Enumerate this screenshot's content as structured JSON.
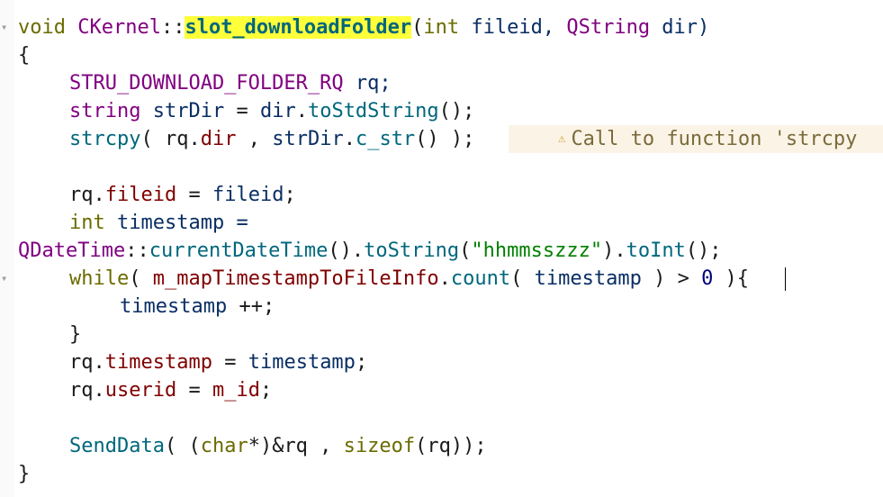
{
  "code": {
    "fn_void": "void",
    "fn_class": "CKernel",
    "fn_sep": "::",
    "fn_name": "slot_downloadFolder",
    "fn_p1": "(",
    "fn_int": "int",
    "fn_p2": " fileid, ",
    "fn_qstring": "QString",
    "fn_p3": " dir)",
    "open_brace": "{",
    "l3_type": "STRU_DOWNLOAD_FOLDER_RQ",
    "l3_rest": " rq;",
    "l4_type": "string",
    "l4_var": " strDir",
    "l4_eq": " = ",
    "l4_obj": "dir",
    "l4_dot": ".",
    "l4_fn": "toStdString",
    "l4_end": "();",
    "l5_fn": "strcpy",
    "l5_a": "( rq.",
    "l5_mem": "dir",
    "l5_b": " , ",
    "l5_obj": "strDir",
    "l5_dot": ".",
    "l5_fn2": "c_str",
    "l5_end": "() );",
    "warning_text": "Call to function 'strcpy",
    "l7_a": "rq.",
    "l7_mem": "fileid",
    "l7_b": " = ",
    "l7_var": "fileid",
    "l7_end": ";",
    "l8_kw": "int",
    "l8_rest": " timestamp =",
    "l9_cls": "QDateTime",
    "l9_sep": "::",
    "l9_fn": "currentDateTime",
    "l9_a": "().",
    "l9_fn2": "toString",
    "l9_b": "(",
    "l9_str": "\"hhmmsszzz\"",
    "l9_c": ").",
    "l9_fn3": "toInt",
    "l9_end": "();",
    "l10_kw": "while",
    "l10_a": "( ",
    "l10_mem": "m_mapTimestampToFileInfo",
    "l10_dot": ".",
    "l10_fn": "count",
    "l10_b": "( ",
    "l10_var": "timestamp",
    "l10_c": " ) > ",
    "l10_num": "0",
    "l10_end": " ){",
    "l11_var": "timestamp",
    "l11_end": " ++;",
    "l12_close": "}",
    "l13_a": "rq.",
    "l13_mem": "timestamp",
    "l13_b": " = ",
    "l13_var": "timestamp",
    "l13_end": ";",
    "l14_a": "rq.",
    "l14_mem": "userid",
    "l14_b": " = ",
    "l14_var": "m_id",
    "l14_end": ";",
    "l16_fn": "SendData",
    "l16_a": "( (",
    "l16_kw": "char",
    "l16_b": "*)&rq , ",
    "l16_kw2": "sizeof",
    "l16_end": "(rq));",
    "close_brace": "}"
  },
  "icons": {
    "fold_marker": "▾",
    "warning": "⚠"
  },
  "colors": {
    "keyword": "#6b6b00",
    "type": "#800080",
    "function": "#00677c",
    "member": "#800000",
    "variable": "#092e64",
    "string": "#008000",
    "highlight": "#ffff3a",
    "warning_bg": "#fbf4e6"
  }
}
